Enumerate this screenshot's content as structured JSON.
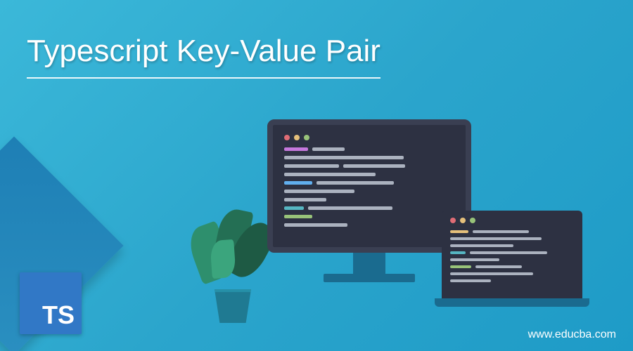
{
  "title": "Typescript Key-Value Pair",
  "ts_badge_text": "TS",
  "website_url": "www.educba.com"
}
